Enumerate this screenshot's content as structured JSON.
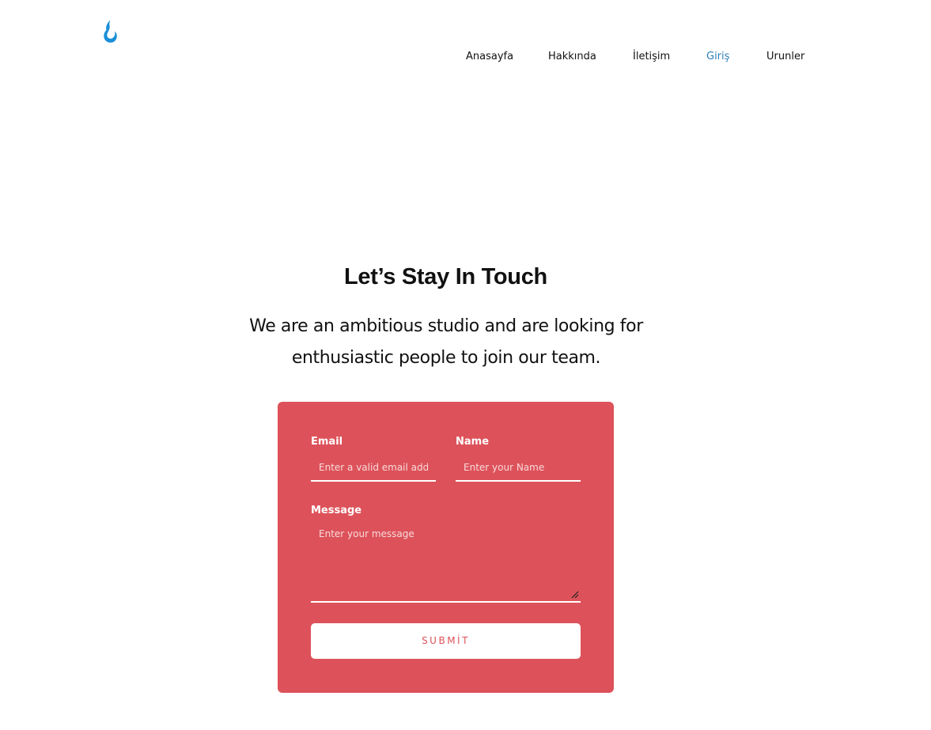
{
  "header": {
    "logo_icon": "water-drop-icon",
    "logo_color": "#1a8fd8",
    "nav": {
      "home": "Anasayfa",
      "about": "Hakkında",
      "contact": "İletişim",
      "login": "Giriş",
      "products": "Urunler"
    },
    "active_item": "Giriş",
    "active_color": "#2f7fb6"
  },
  "hero": {
    "title": "Let’s Stay In Touch",
    "subtitle": "We are an ambitious studio and are looking for enthusiastic people to join our team."
  },
  "form": {
    "background": "#dd525a",
    "email_label": "Email",
    "email_placeholder": "Enter a valid email address",
    "name_label": "Name",
    "name_placeholder": "Enter your Name",
    "message_label": "Message",
    "message_placeholder": "Enter your message",
    "submit_label": "SUBMİT"
  }
}
